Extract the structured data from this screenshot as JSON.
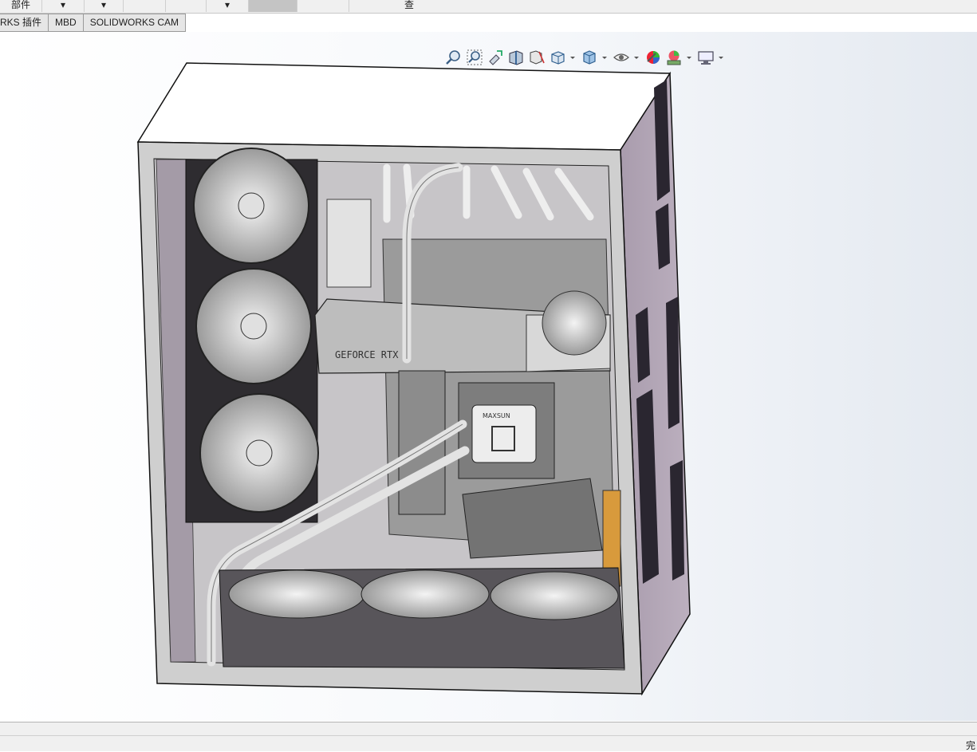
{
  "toolbar": {
    "parts_label": "部件",
    "view_label": "查"
  },
  "tabs": [
    {
      "label": "RKS 插件"
    },
    {
      "label": "MBD"
    },
    {
      "label": "SOLIDWORKS CAM"
    }
  ],
  "hud": {
    "icons": [
      "zoom-to-fit-icon",
      "zoom-to-area-icon",
      "previous-view-icon",
      "section-view-icon",
      "dynamic-annotation-view-icon",
      "view-orientation-icon",
      "display-style-icon",
      "hide-show-items-icon",
      "edit-appearance-icon",
      "apply-scene-icon",
      "view-settings-icon"
    ]
  },
  "model": {
    "gpu_brand_text": "GEFORCE RTX",
    "cpu_block_text": "MAXSUN"
  },
  "status": {
    "text": "完"
  },
  "colors": {
    "case_side_panel": "#b0a3b3",
    "case_top": "#ffffff",
    "case_frame": "#c9c9c9",
    "radiator": "#58555a",
    "hose": "#e0e0e0",
    "accent_orange": "#d89a3c",
    "viewport_gradient_end": "#e4e9f0"
  }
}
